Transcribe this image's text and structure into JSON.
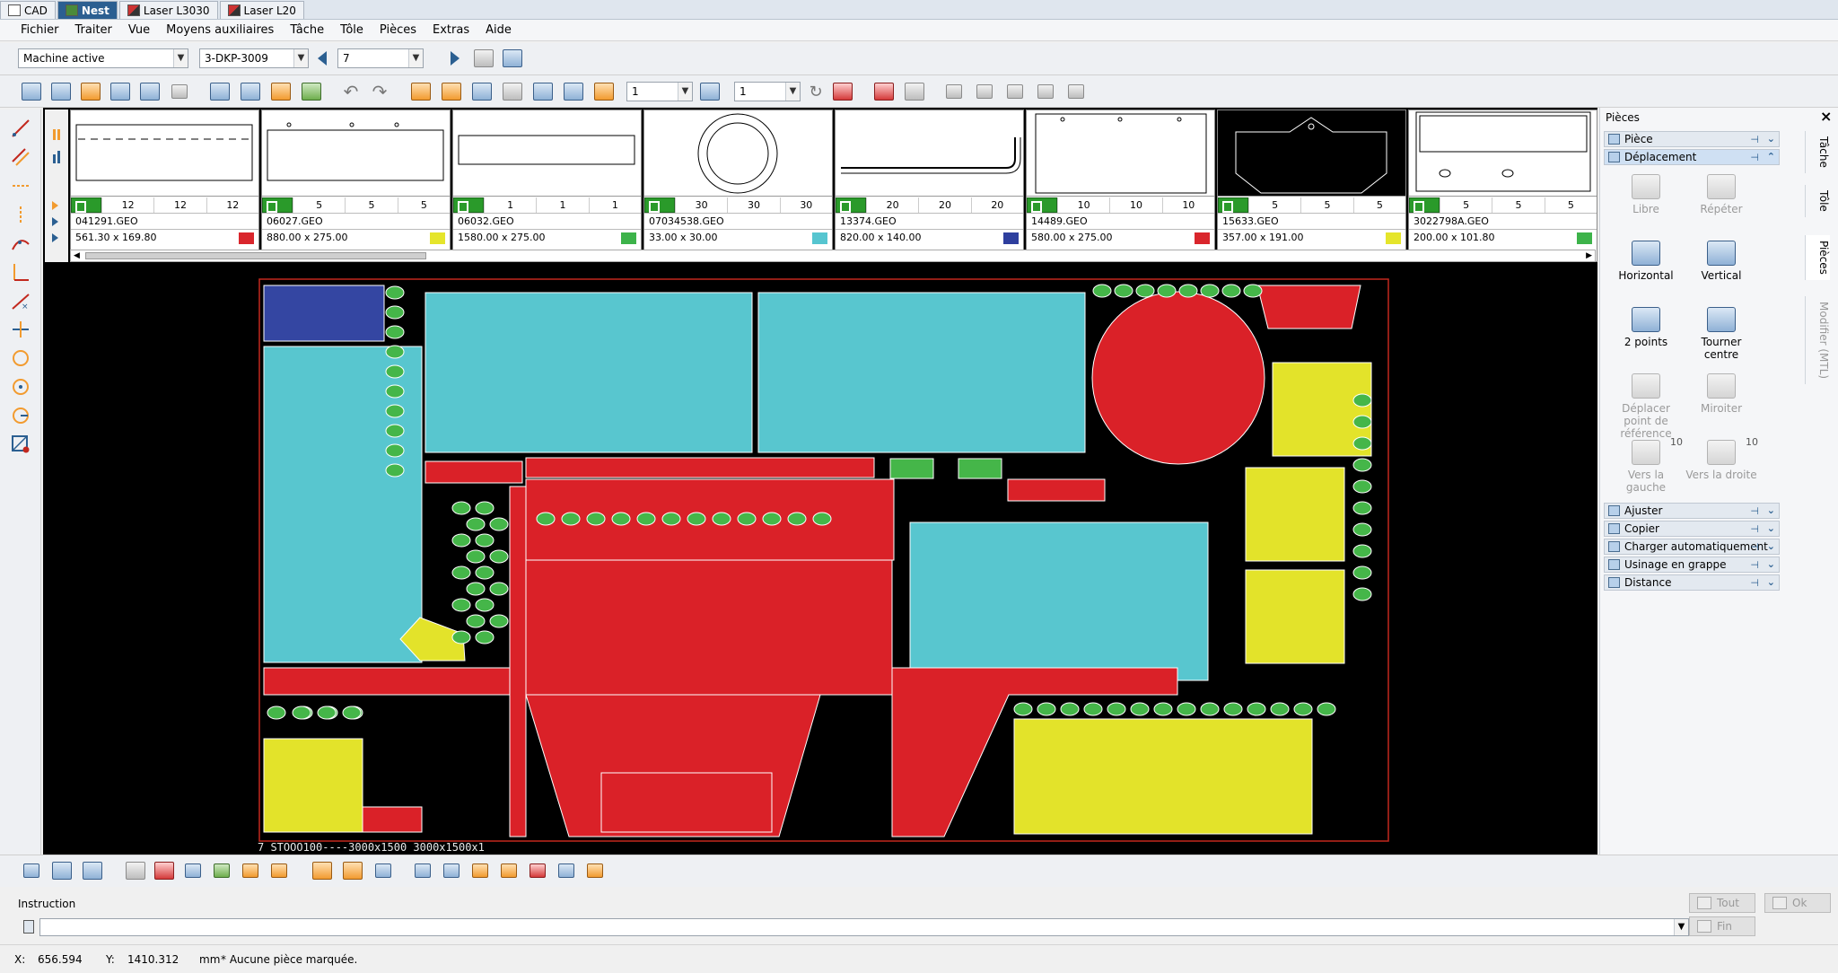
{
  "app_tabs": [
    {
      "label": "CAD",
      "active": false
    },
    {
      "label": "Nest",
      "active": true
    },
    {
      "label": "Laser L3030",
      "active": false
    },
    {
      "label": "Laser L20",
      "active": false
    }
  ],
  "menu": [
    "Fichier",
    "Traiter",
    "Vue",
    "Moyens auxiliaires",
    "Tâche",
    "Tôle",
    "Pièces",
    "Extras",
    "Aide"
  ],
  "toolbar1": {
    "machine": "Machine active",
    "program": "3-DKP-3009",
    "sheet_no": "7"
  },
  "toolbar2": {
    "count_a": "1",
    "count_b": "1"
  },
  "parts": [
    {
      "qty": [
        "12",
        "12",
        "12"
      ],
      "file": "041291.GEO",
      "dims": "561.30 x 169.80",
      "color": "#d9262c"
    },
    {
      "qty": [
        "5",
        "5",
        "5"
      ],
      "file": "06027.GEO",
      "dims": "880.00 x 275.00",
      "color": "#e5e52b"
    },
    {
      "qty": [
        "1",
        "1",
        "1"
      ],
      "file": "06032.GEO",
      "dims": "1580.00 x 275.00",
      "color": "#3db34a"
    },
    {
      "qty": [
        "30",
        "30",
        "30"
      ],
      "file": "07034538.GEO",
      "dims": "33.00 x 30.00",
      "color": "#56c5d0"
    },
    {
      "qty": [
        "20",
        "20",
        "20"
      ],
      "file": "13374.GEO",
      "dims": "820.00 x 140.00",
      "color": "#2e3f9e"
    },
    {
      "qty": [
        "10",
        "10",
        "10"
      ],
      "file": "14489.GEO",
      "dims": "580.00 x 275.00",
      "color": "#d9262c"
    },
    {
      "qty": [
        "5",
        "5",
        "5"
      ],
      "file": "15633.GEO",
      "dims": "357.00 x 191.00",
      "color": "#e5e52b"
    },
    {
      "qty": [
        "5",
        "5",
        "5"
      ],
      "file": "3022798A.GEO",
      "dims": "200.00 x 101.80",
      "color": "#3db34a"
    }
  ],
  "sheet_label": "7 STOOO100----3000x1500  3000x1500x1",
  "colors": {
    "red": "#da2128",
    "cyan": "#58c6cf",
    "blue": "#3446a2",
    "yellow": "#e3e32a",
    "green": "#45b649",
    "sheet_border": "#c2281e"
  },
  "right_panel": {
    "title": "Pièces",
    "sections_top": [
      {
        "label": "Pièce",
        "icon": "part-icon"
      },
      {
        "label": "Déplacement",
        "icon": "move-icon"
      }
    ],
    "buttons": [
      {
        "label": "Libre",
        "enabled": false,
        "count": ""
      },
      {
        "label": "Répéter",
        "enabled": false,
        "count": ""
      },
      {
        "label": "Horizontal",
        "enabled": true,
        "count": ""
      },
      {
        "label": "Vertical",
        "enabled": true,
        "count": ""
      },
      {
        "label": "2 points",
        "enabled": true,
        "count": ""
      },
      {
        "label": "Tourner centre",
        "enabled": true,
        "count": ""
      },
      {
        "label": "Déplacer point de référence",
        "enabled": false,
        "count": ""
      },
      {
        "label": "Miroiter",
        "enabled": false,
        "count": ""
      },
      {
        "label": "Vers la gauche",
        "enabled": false,
        "count": "10"
      },
      {
        "label": "Vers la droite",
        "enabled": false,
        "count": "10"
      }
    ],
    "sections_bottom": [
      {
        "label": "Ajuster",
        "icon": "adjust-icon"
      },
      {
        "label": "Copier",
        "icon": "copy-icon"
      },
      {
        "label": "Charger automatiquement",
        "icon": "autoload-icon"
      },
      {
        "label": "Usinage en grappe",
        "icon": "cluster-icon"
      },
      {
        "label": "Distance",
        "icon": "distance-icon"
      }
    ],
    "vertical_tabs": [
      "Tâche",
      "Tôle",
      "Pièces",
      "Modifier (MTL)"
    ]
  },
  "instruction": {
    "label": "Instruction",
    "value": "",
    "buttons": {
      "tout": "Tout",
      "ok": "Ok",
      "fin": "Fin"
    }
  },
  "status": {
    "x_label": "X:",
    "x_value": "656.594",
    "y_label": "Y:",
    "y_value": "1410.312",
    "unit": "mm",
    "message": "* Aucune pièce marquée."
  }
}
